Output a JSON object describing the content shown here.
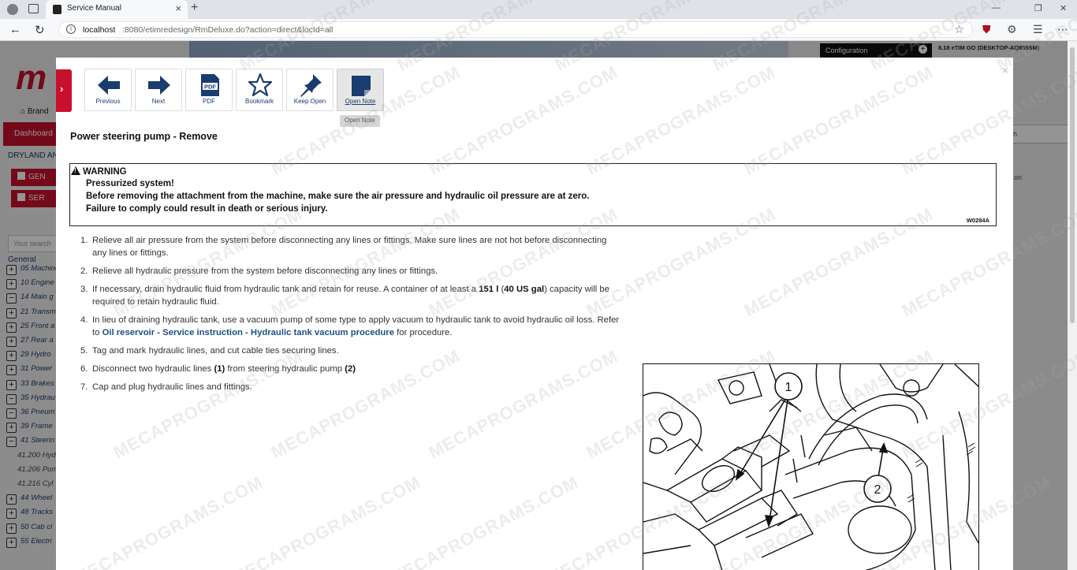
{
  "browser": {
    "tab_title": "Service Manual",
    "url_host": "localhost",
    "url_rest": ":8080/etimredesign/RmDeluxe.do?action=direct&locId=all"
  },
  "app": {
    "logo_text": "m",
    "config_label": "Configuration",
    "version_text": "8.18 eTIM GO (DESKTOP-AQ855SM)",
    "brand_label": "Brand",
    "dashboard_label": "Dashboard",
    "dryland_label": "DRYLAND AN",
    "gen_button": "GEN",
    "ser_button": "SER",
    "search_placeholder": "Your search",
    "general_label": "General",
    "tree": [
      {
        "pm": "+",
        "label": "05 Machine"
      },
      {
        "pm": "+",
        "label": "10 Engine"
      },
      {
        "pm": "−",
        "label": "14 Main g"
      },
      {
        "pm": "+",
        "label": "21 Transm"
      },
      {
        "pm": "+",
        "label": "25 Front a"
      },
      {
        "pm": "+",
        "label": "27 Rear a"
      },
      {
        "pm": "+",
        "label": "29 Hydro"
      },
      {
        "pm": "+",
        "label": "31 Power"
      },
      {
        "pm": "+",
        "label": "33 Brakes"
      },
      {
        "pm": "−",
        "label": "35 Hydrau"
      },
      {
        "pm": "−",
        "label": "36 Pneum"
      },
      {
        "pm": "+",
        "label": "39 Frame"
      },
      {
        "pm": "−",
        "label": "41 Steerin"
      }
    ],
    "subtree": [
      "41.200 Hyd",
      "41.206 Pum",
      "41.216 Cyl"
    ],
    "tree2": [
      {
        "pm": "+",
        "label": "44 Wheel"
      },
      {
        "pm": "+",
        "label": "48 Tracks"
      },
      {
        "pm": "+",
        "label": "50 Cab cl"
      },
      {
        "pm": "+",
        "label": "55 Electri"
      }
    ],
    "right_select": "h",
    "right_text": "on"
  },
  "toolbar": {
    "previous": "Previous",
    "next": "Next",
    "pdf": "PDF",
    "bookmark": "Bookmark",
    "keep_open": "Keep Open",
    "open_note": "Open Note",
    "tooltip": "Open Note"
  },
  "document": {
    "title": "Power steering pump - Remove",
    "warning": {
      "heading": "WARNING",
      "line1": "Pressurized system!",
      "line2": "Before removing the attachment from the machine, make sure the air pressure and hydraulic oil pressure are at zero.",
      "line3": "Failure to comply could result in death or serious injury.",
      "code": "W0284A"
    },
    "steps": {
      "s1": "Relieve all air pressure from the system before disconnecting any lines or fittings. Make sure lines are not hot before disconnecting any lines or fittings.",
      "s2": "Relieve all hydraulic pressure from the system before disconnecting any lines or fittings.",
      "s3_a": "If necessary, drain hydraulic fluid from hydraulic tank and retain for reuse. A container of at least a ",
      "s3_b1": "151 l",
      "s3_b2": " (",
      "s3_b3": "40 US gal",
      "s3_c": ") capacity will be required to retain hydraulic fluid.",
      "s4_a": "In lieu of draining hydraulic tank, use a vacuum pump of some type to apply vacuum to hydraulic tank to avoid hydraulic oil loss. Refer to ",
      "s4_link": "Oil reservoir - Service instruction - Hydraulic tank vacuum procedure",
      "s4_c": " for procedure.",
      "s5": "Tag and mark hydraulic lines, and cut cable ties securing lines.",
      "s6_a": "Disconnect two hydraulic lines ",
      "s6_b": "(1)",
      "s6_c": " from steering hydraulic pump ",
      "s6_d": "(2)",
      "s7": "Cap and plug hydraulic lines and fittings."
    },
    "figure": {
      "callout1": "1",
      "callout2": "2"
    }
  },
  "watermark": "MECAPROGRAMS.COM",
  "colors": {
    "brand_red": "#c8102e",
    "link_blue": "#1a4f8b",
    "icon_blue": "#1a3c6e"
  }
}
